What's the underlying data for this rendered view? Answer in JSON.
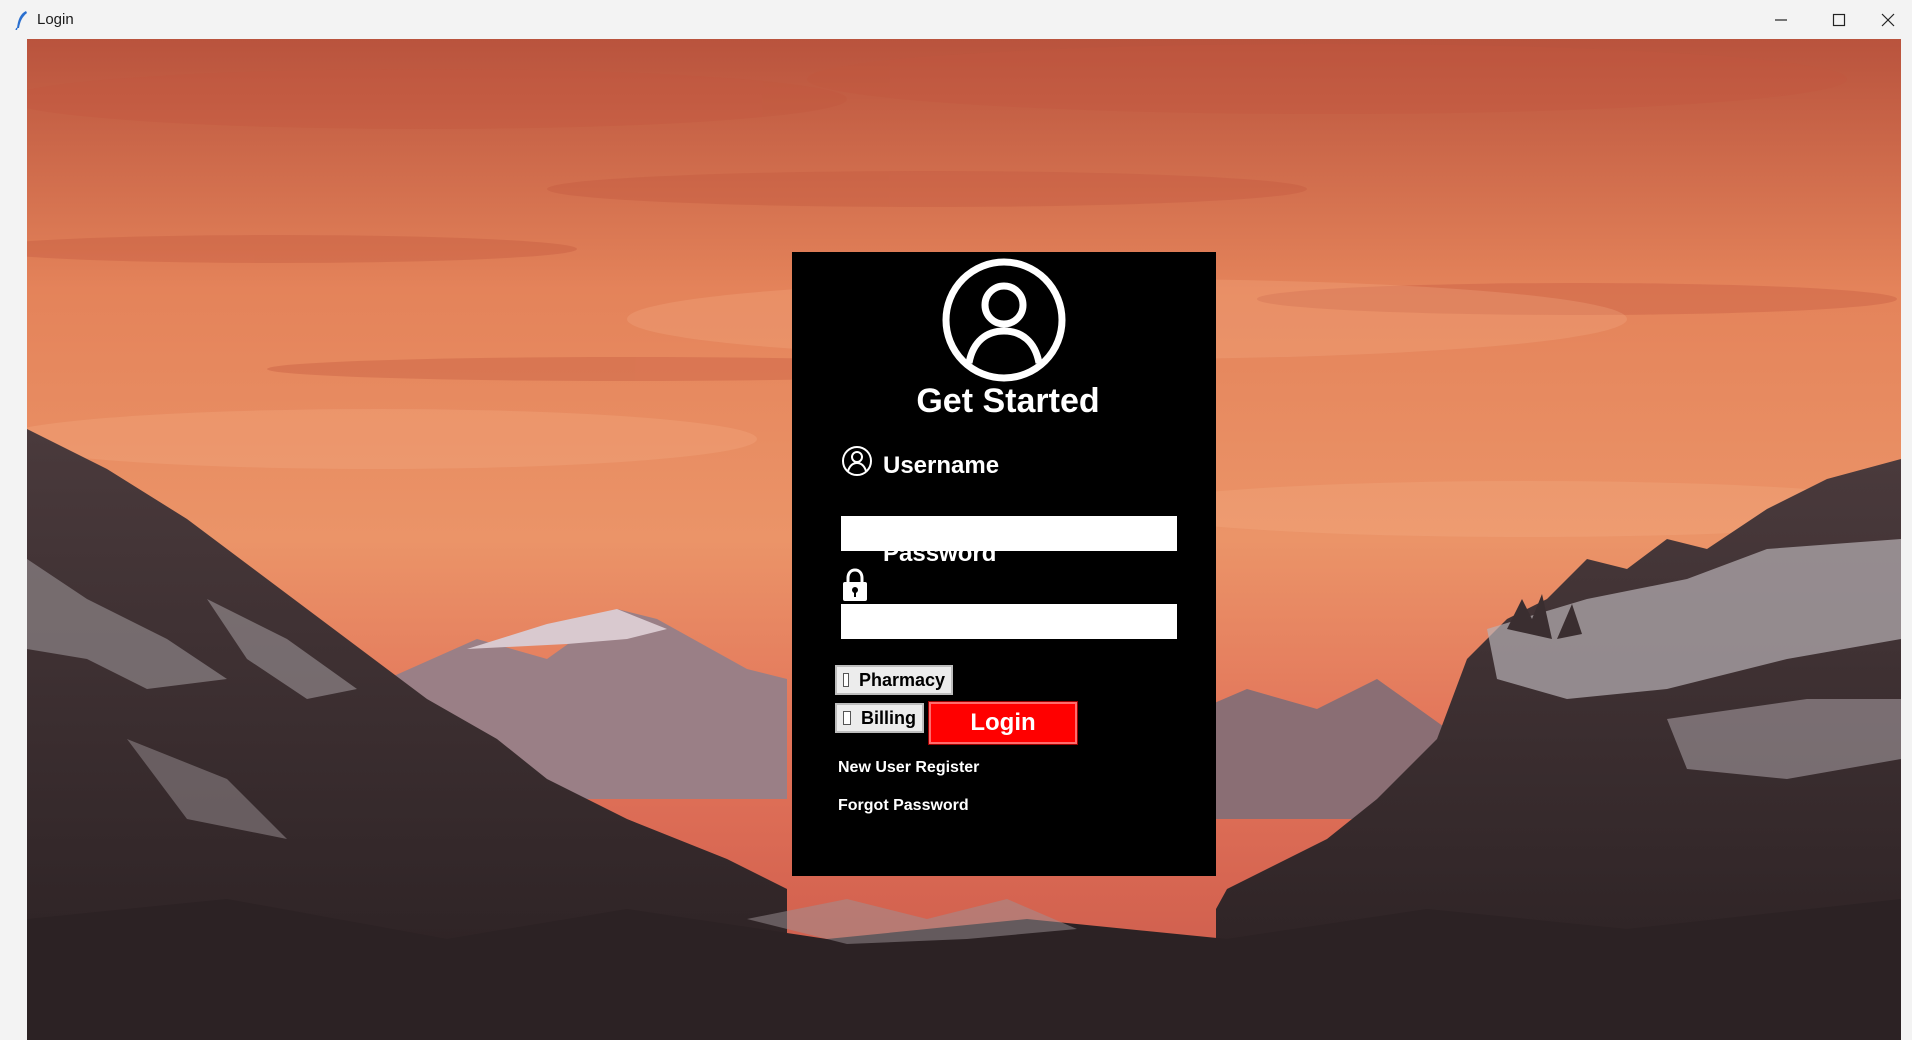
{
  "window": {
    "title": "Login",
    "controls": [
      "minimize-icon",
      "maximize-icon",
      "close-icon"
    ]
  },
  "form": {
    "heading": "Get Started",
    "username_label": "Username",
    "username_value": "",
    "password_label": "Password",
    "password_value": "",
    "options": [
      {
        "label": "Pharmacy",
        "checked": false
      },
      {
        "label": "Billing",
        "checked": false
      }
    ],
    "login_label": "Login",
    "register_link": "New User Register",
    "forgot_link": "Forgot Password"
  },
  "colors": {
    "panel_bg": "#000000",
    "login_button": "#ff0000",
    "text": "#ffffff"
  }
}
